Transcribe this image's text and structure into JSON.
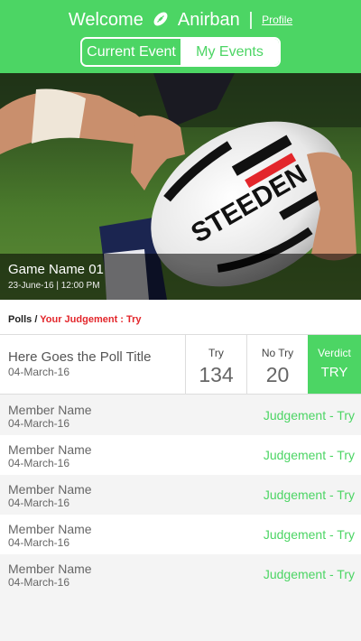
{
  "header": {
    "welcome_label": "Welcome",
    "user_name": "Anirban",
    "separator": "|",
    "profile_link": "Profile",
    "tabs": [
      {
        "label": "Current Event",
        "active": true
      },
      {
        "label": "My Events",
        "active": false
      }
    ],
    "accent_color": "#4cd564",
    "icon": "football-icon"
  },
  "event": {
    "game_name": "Game Name 01",
    "game_date": "23-June-16 | 12:00 PM",
    "ball_brand": "STEEDEN"
  },
  "polls": {
    "section_label": "Polls /",
    "judgement_label": "Your Judgement : Try",
    "judgement_color": "#e3262b"
  },
  "poll": {
    "title": "Here Goes the Poll Title",
    "date": "04-March-16",
    "try_label": "Try",
    "try_count": "134",
    "no_try_label": "No Try",
    "no_try_count": "20",
    "verdict_label": "Verdict",
    "verdict_value": "TRY"
  },
  "members": [
    {
      "name": "Member Name",
      "date": "04-March-16",
      "judgement": "Judgement - Try"
    },
    {
      "name": "Member Name",
      "date": "04-March-16",
      "judgement": "Judgement - Try"
    },
    {
      "name": "Member Name",
      "date": "04-March-16",
      "judgement": "Judgement - Try"
    },
    {
      "name": "Member Name",
      "date": "04-March-16",
      "judgement": "Judgement - Try"
    },
    {
      "name": "Member Name",
      "date": "04-March-16",
      "judgement": "Judgement - Try"
    }
  ]
}
